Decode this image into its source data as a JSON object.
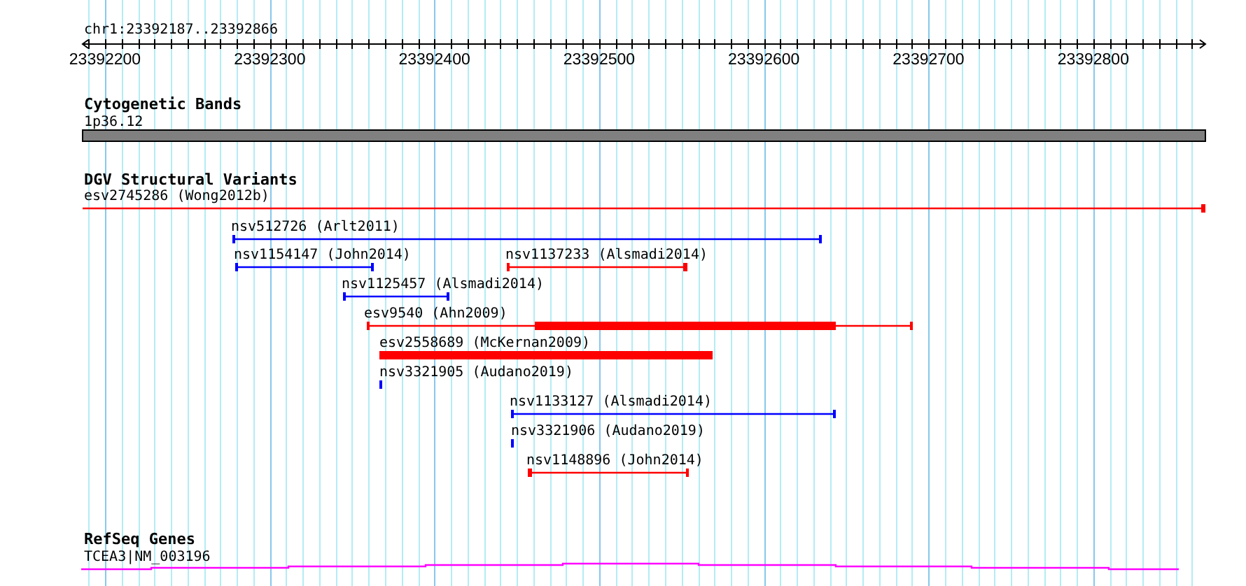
{
  "ruler": {
    "location": "chr1:23392187..23392866",
    "tick_labels": [
      "23392200",
      "23392300",
      "23392400",
      "23392500",
      "23392600",
      "23392700",
      "23392800"
    ]
  },
  "tracks": [
    {
      "kind": "cytoband",
      "title": "Cytogenetic Bands",
      "features": [
        {
          "label": "1p36.12"
        }
      ]
    },
    {
      "kind": "variants",
      "title": "DGV Structural Variants",
      "features": [
        {
          "label": "esv2745286 (Wong2012b)",
          "color": "#ff0000",
          "kind": "line"
        },
        {
          "label": "nsv512726 (Arlt2011)",
          "color": "#0000ff",
          "kind": "line"
        },
        {
          "label": "nsv1154147 (John2014)",
          "color": "#0000ff",
          "kind": "line"
        },
        {
          "label": "nsv1137233 (Alsmadi2014)",
          "color": "#ff0000",
          "kind": "line"
        },
        {
          "label": "nsv1125457 (Alsmadi2014)",
          "color": "#0000ff",
          "kind": "line"
        },
        {
          "label": "esv9540 (Ahn2009)",
          "color": "#ff0000",
          "kind": "line_thick"
        },
        {
          "label": "esv2558689 (McKernan2009)",
          "color": "#ff0000",
          "kind": "thick"
        },
        {
          "label": "nsv3321905 (Audano2019)",
          "color": "#0000ff",
          "kind": "tick"
        },
        {
          "label": "nsv1133127 (Alsmadi2014)",
          "color": "#0000ff",
          "kind": "line"
        },
        {
          "label": "nsv3321906 (Audano2019)",
          "color": "#0000ff",
          "kind": "tick"
        },
        {
          "label": "nsv1148896 (John2014)",
          "color": "#ff0000",
          "kind": "line"
        }
      ]
    },
    {
      "kind": "gene",
      "title": "RefSeq Genes",
      "features": [
        {
          "label": "TCEA3|NM_003196"
        }
      ]
    }
  ]
}
